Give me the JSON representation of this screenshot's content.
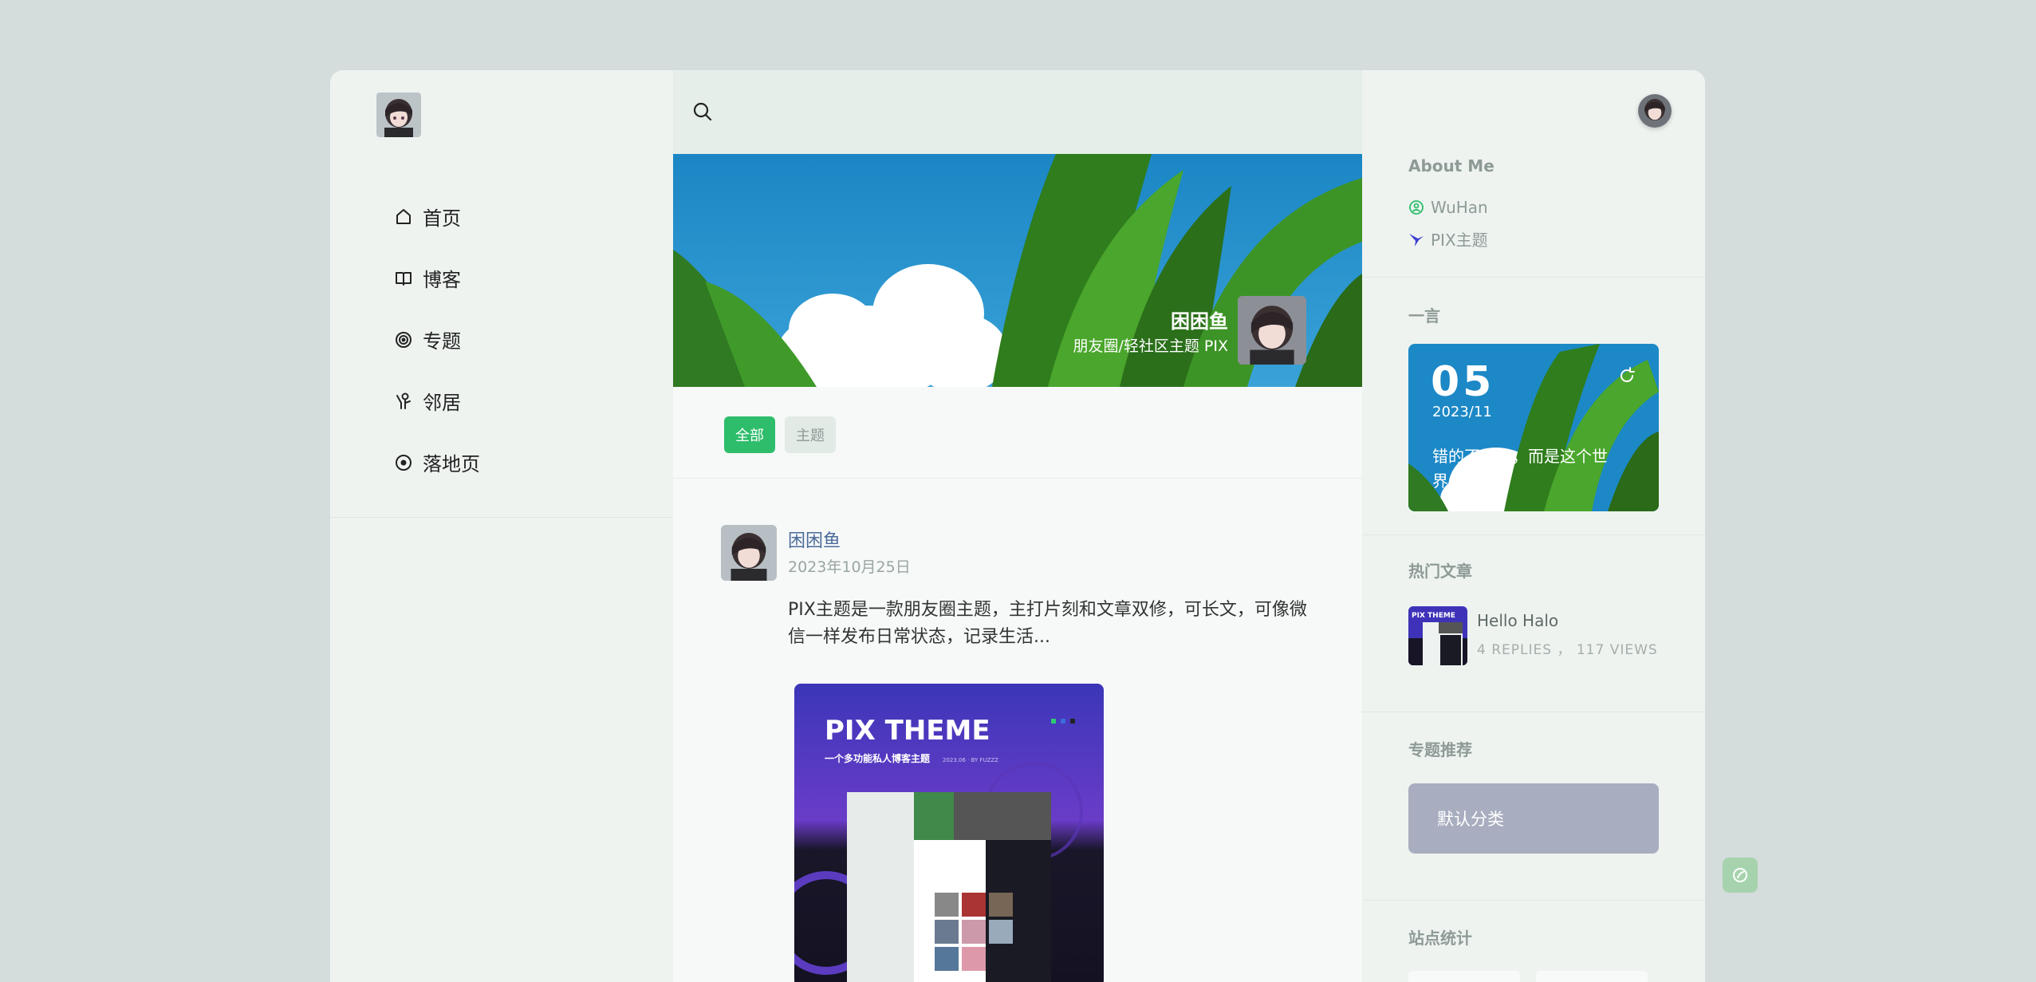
{
  "nav": {
    "items": [
      {
        "label": "首页",
        "icon": "home-icon"
      },
      {
        "label": "博客",
        "icon": "book-icon"
      },
      {
        "label": "专题",
        "icon": "target-icon"
      },
      {
        "label": "邻居",
        "icon": "neighbor-icon"
      },
      {
        "label": "落地页",
        "icon": "landing-icon"
      }
    ]
  },
  "banner": {
    "name": "困困鱼",
    "tagline": "朋友圈/轻社区主题 PIX"
  },
  "filters": [
    {
      "label": "全部",
      "active": true
    },
    {
      "label": "主题",
      "active": false
    }
  ],
  "post": {
    "author": "困困鱼",
    "date": "2023年10月25日",
    "text": "PIX主题是一款朋友圈主题，主打片刻和文章双修，可长文，可像微信一样发布日常状态，记录生活...",
    "image": {
      "title": "PIX THEME",
      "subtitle": "一个多功能私人博客主题",
      "meta": "2023.06 · BY FUZZZ"
    }
  },
  "sidebar": {
    "about_title": "About Me",
    "location": "WuHan",
    "theme_link": "PIX主题",
    "quote_title": "一言",
    "quote": {
      "day": "05",
      "month": "2023/11",
      "text": "错的不是我，而是这个世界!"
    },
    "hot_title": "热门文章",
    "hot_post": {
      "title": "Hello Halo",
      "meta": "4 REPLIES ，  117 VIEWS",
      "thumb_title": "PIX THEME"
    },
    "topic_title": "专题推荐",
    "topic_card": "默认分类",
    "stats_title": "站点统计"
  },
  "colors": {
    "accent_green": "#2ebd6b",
    "link_blue": "#4b6b9a",
    "topic_card": "#a8adbf",
    "page_bg": "#d4dcdc"
  }
}
